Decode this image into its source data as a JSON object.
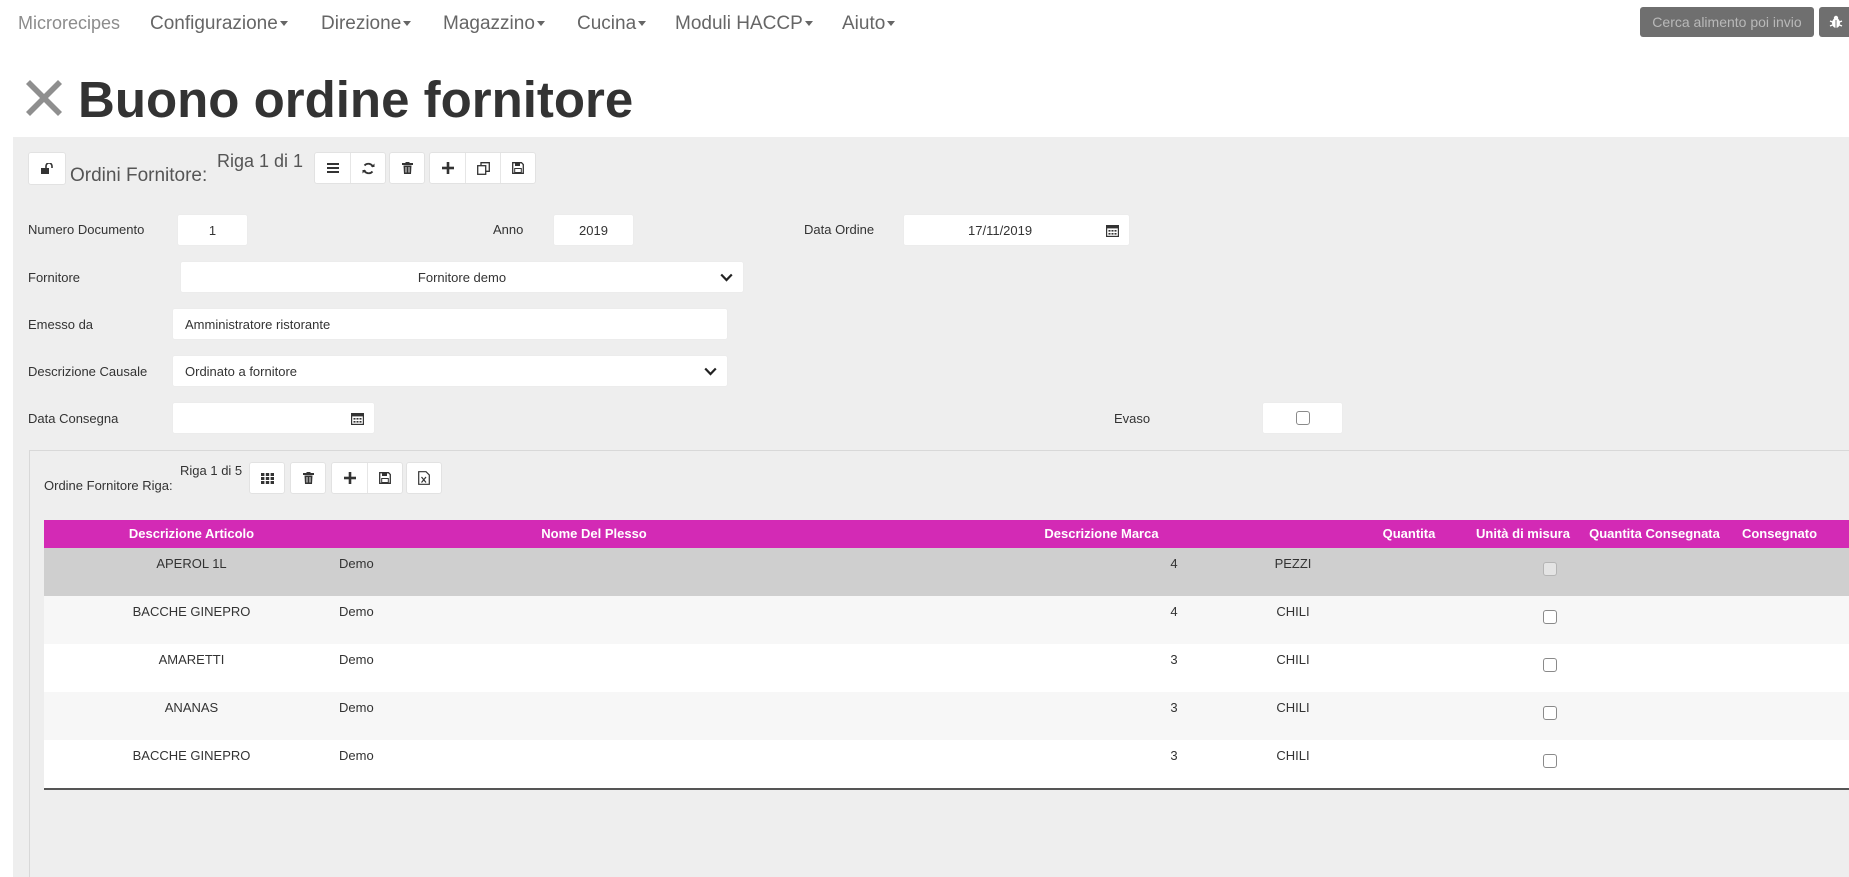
{
  "nav": {
    "brand": "Microrecipes",
    "items": [
      "Configurazione",
      "Direzione",
      "Magazzino",
      "Cucina",
      "Moduli HACCP",
      "Aiuto"
    ],
    "search_label": "Cerca alimento poi invio"
  },
  "page": {
    "title": "Buono ordine fornitore"
  },
  "header_toolbar": {
    "label": "Ordini Fornitore:",
    "record": "Riga 1 di 1"
  },
  "form": {
    "numero_documento": {
      "label": "Numero Documento",
      "value": "1"
    },
    "anno": {
      "label": "Anno",
      "value": "2019"
    },
    "data_ordine": {
      "label": "Data Ordine",
      "value": "17/11/2019"
    },
    "fornitore": {
      "label": "Fornitore",
      "value": "Fornitore demo"
    },
    "emesso_da": {
      "label": "Emesso da",
      "value": "Amministratore ristorante"
    },
    "descrizione_causale": {
      "label": "Descrizione Causale",
      "value": "Ordinato a fornitore"
    },
    "data_consegna": {
      "label": "Data Consegna",
      "value": ""
    },
    "evaso": {
      "label": "Evaso",
      "checked": false
    }
  },
  "rows_toolbar": {
    "label": "Ordine Fornitore Riga:",
    "record": "Riga 1 di 5"
  },
  "grid": {
    "headers": [
      "Descrizione Articolo",
      "Nome Del Plesso",
      "Descrizione Marca",
      "Quantita",
      "Unità di misura",
      "Quantita Consegnata",
      "Consegnato"
    ],
    "rows": [
      {
        "articolo": "APEROL 1L",
        "plesso": "Demo",
        "marca": "",
        "quantita": "4",
        "unita": "PEZZI",
        "consegnata": "",
        "consegnato": false,
        "selected": true
      },
      {
        "articolo": "BACCHE GINEPRO",
        "plesso": "Demo",
        "marca": "",
        "quantita": "4",
        "unita": "CHILI",
        "consegnata": "",
        "consegnato": false,
        "selected": false
      },
      {
        "articolo": "AMARETTI",
        "plesso": "Demo",
        "marca": "",
        "quantita": "3",
        "unita": "CHILI",
        "consegnata": "",
        "consegnato": false,
        "selected": false
      },
      {
        "articolo": "ANANAS",
        "plesso": "Demo",
        "marca": "",
        "quantita": "3",
        "unita": "CHILI",
        "consegnata": "",
        "consegnato": false,
        "selected": false
      },
      {
        "articolo": "BACCHE GINEPRO",
        "plesso": "Demo",
        "marca": "",
        "quantita": "3",
        "unita": "CHILI",
        "consegnata": "",
        "consegnato": false,
        "selected": false
      }
    ]
  },
  "colors": {
    "accent": "#d32ab5",
    "panel": "#eeeeee",
    "selected_row": "#cfcfcf",
    "alt_row": "#f7f7f7"
  }
}
